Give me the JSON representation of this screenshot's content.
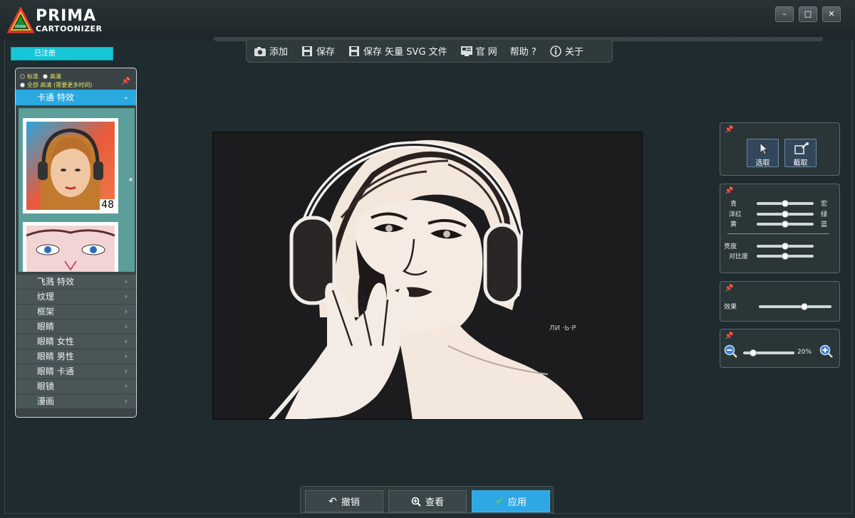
{
  "app": {
    "logo_line1": "PRIMA",
    "logo_line2": "CARTOONIZER",
    "logo_mark": "PRIMA"
  },
  "window_controls": {
    "minimize": "minimize-icon",
    "maximize": "maximize-icon",
    "close": "close-icon"
  },
  "menu": {
    "items": [
      {
        "label": "添加",
        "icon": "camera-icon"
      },
      {
        "label": "保存",
        "icon": "floppy-icon"
      },
      {
        "label": "保存 矢量 SVG 文件",
        "icon": "floppy-icon"
      },
      {
        "label": "官 网",
        "icon": "website-icon"
      },
      {
        "label": "帮助 ?",
        "icon": ""
      },
      {
        "label": "关于",
        "icon": "info-icon"
      }
    ]
  },
  "registered_label": "已注册",
  "left_panel": {
    "quality": {
      "standard": "标准",
      "hd": "高清",
      "full_hd": "全部 高清 (需要更多时间)"
    },
    "active_section": "卡通 特效",
    "thumbnail_count": "48",
    "sections": [
      "飞溅 特效",
      "纹理",
      "框架",
      "眼睛",
      "眼睛 女性",
      "眼睛 男性",
      "眼睛 卡通",
      "眼镜",
      "漫画"
    ]
  },
  "canvas": {
    "watermark": "ЛИ ·Ь·Р"
  },
  "right_panels": {
    "tools": {
      "select_label": "选取",
      "crop_label": "截取"
    },
    "color": {
      "rows": [
        {
          "left": "青",
          "right": "宏",
          "value": 0.5
        },
        {
          "left": "洋红",
          "right": "绿",
          "value": 0.5
        },
        {
          "left": "黄",
          "right": "蓝",
          "value": 0.5
        }
      ],
      "brightness_label": "亮度",
      "brightness_value": 0.5,
      "contrast_label": "对比度",
      "contrast_value": 0.5
    },
    "effect": {
      "label": "效果",
      "value": 0.65
    },
    "zoom": {
      "value_text": "20%",
      "value": 0.2
    }
  },
  "bottom": {
    "undo": "撤销",
    "view": "查看",
    "apply": "应用"
  },
  "colors": {
    "accent": "#2ea7e4",
    "registered": "#17c6d6",
    "background": "#1f2b2f"
  }
}
